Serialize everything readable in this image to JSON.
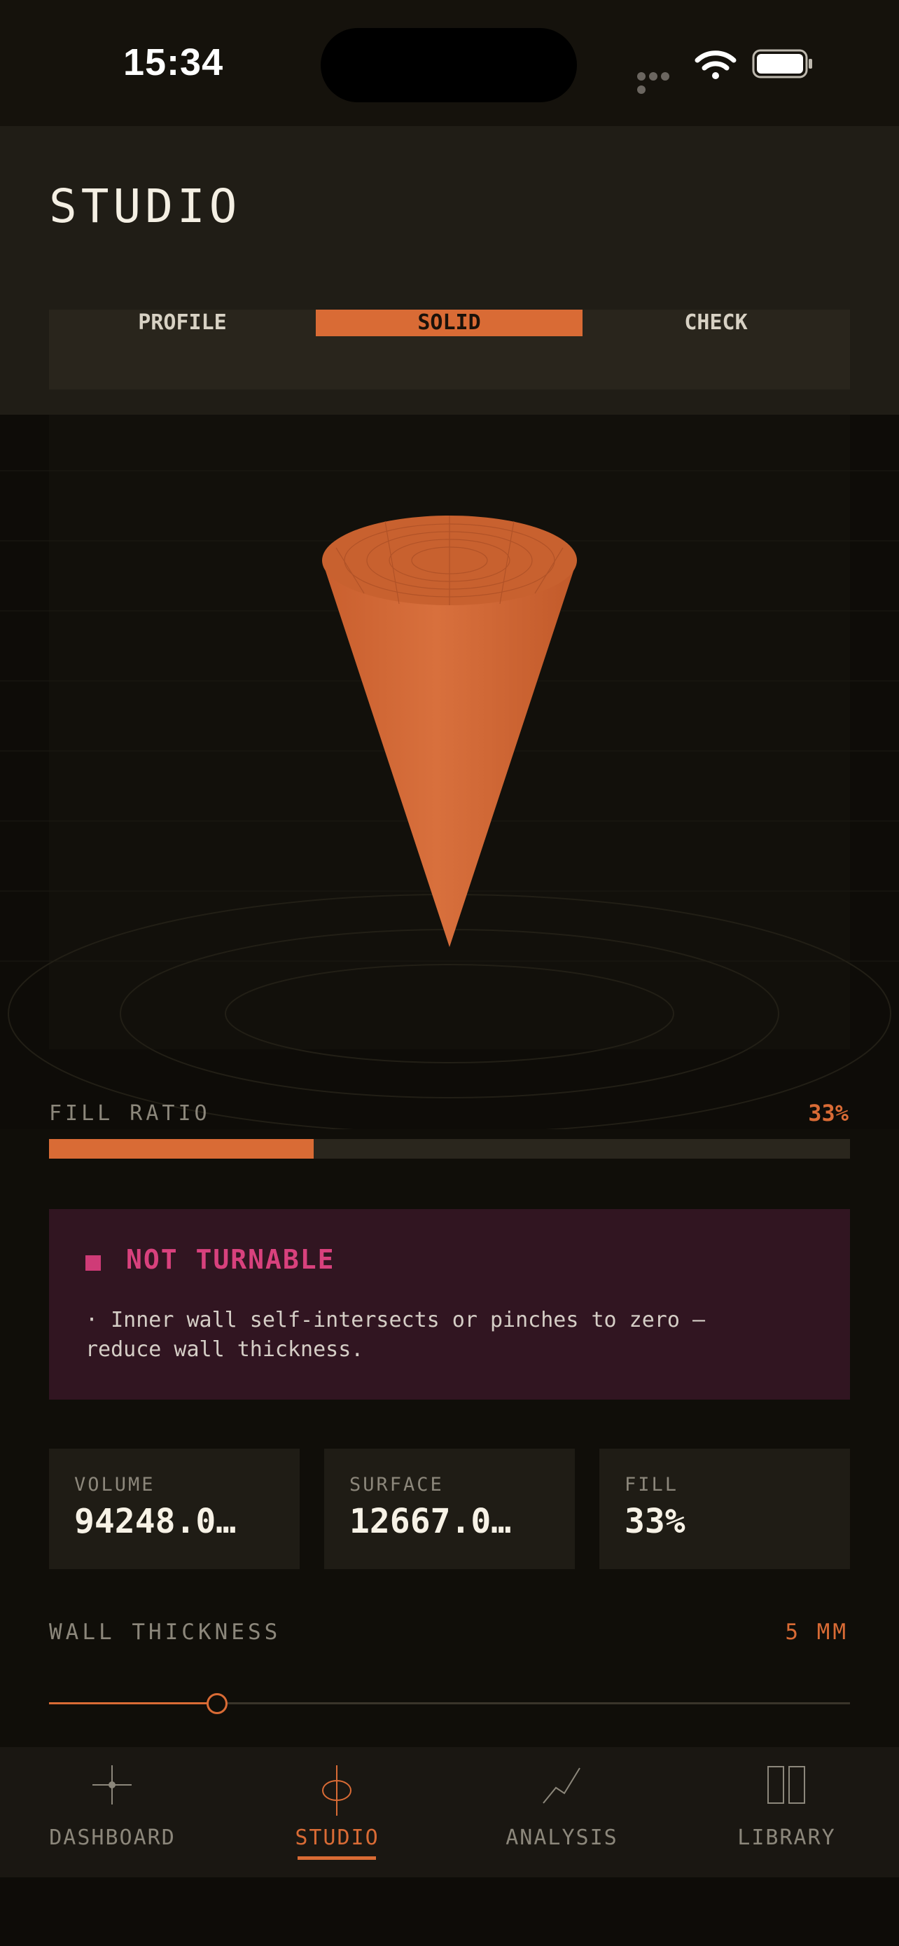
{
  "status": {
    "time": "15:34"
  },
  "header": {
    "title": "STUDIO",
    "tabs": [
      {
        "label": "PROFILE",
        "active": false
      },
      {
        "label": "SOLID",
        "active": true
      },
      {
        "label": "CHECK",
        "active": false
      }
    ]
  },
  "viewport": {
    "model_color": "#d96b35",
    "shape": "cone"
  },
  "fill_ratio": {
    "label": "FILL RATIO",
    "value": "33%",
    "fraction": 0.33
  },
  "alert": {
    "title": "NOT TURNABLE",
    "message": "· Inner wall self-intersects or pinches to zero —\nreduce wall thickness.",
    "color": "#d8417d"
  },
  "metrics": [
    {
      "label": "VOLUME",
      "value": "94248.0…"
    },
    {
      "label": "SURFACE",
      "value": "12667.0…"
    },
    {
      "label": "FILL",
      "value": "33%"
    }
  ],
  "wall_thickness": {
    "label": "WALL THICKNESS",
    "value": "5 MM",
    "slider_fraction": 0.21
  },
  "tabbar": {
    "items": [
      {
        "label": "DASHBOARD",
        "icon": "crosshair-icon",
        "active": false
      },
      {
        "label": "STUDIO",
        "icon": "lathe-icon",
        "active": true
      },
      {
        "label": "ANALYSIS",
        "icon": "line-chart-icon",
        "active": false
      },
      {
        "label": "LIBRARY",
        "icon": "book-icon",
        "active": false
      }
    ]
  },
  "colors": {
    "accent": "#d96b35",
    "background": "#100e09",
    "alert_bg": "#311521"
  }
}
